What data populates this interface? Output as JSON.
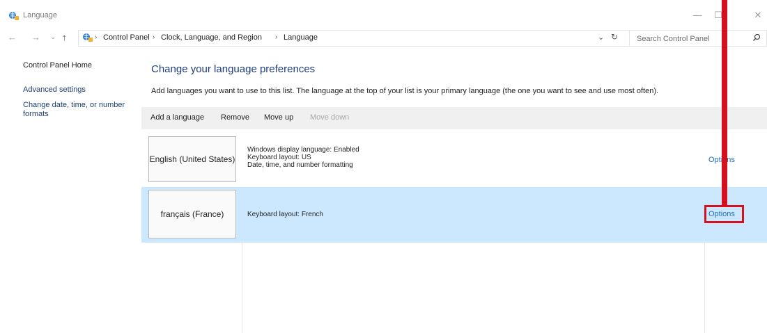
{
  "window": {
    "title": "Language",
    "minimize": "—",
    "maximize": "☐",
    "close": "✕"
  },
  "nav": {
    "back": "←",
    "forward": "→",
    "recent": "⌄",
    "up": "↑"
  },
  "breadcrumb": {
    "items": [
      "Control Panel",
      "Clock, Language, and Region",
      "Language"
    ],
    "separator": "›",
    "dropdown": "⌄",
    "refresh": "↻"
  },
  "search": {
    "placeholder": "Search Control Panel"
  },
  "sidebar": {
    "home": "Control Panel Home",
    "advanced": "Advanced settings",
    "formats": "Change date, time, or number formats"
  },
  "main": {
    "heading": "Change your language preferences",
    "description": "Add languages you want to use to this list. The language at the top of your list is your primary language (the one you want to see and use most often)."
  },
  "toolbar": {
    "add": "Add a language",
    "remove": "Remove",
    "move_up": "Move up",
    "move_down": "Move down"
  },
  "languages": [
    {
      "name": "English (United States)",
      "details": [
        "Windows display language: Enabled",
        "Keyboard layout: US",
        "Date, time, and number formatting"
      ],
      "options": "Options",
      "selected": false
    },
    {
      "name": "français (France)",
      "details": [
        "Keyboard layout: French"
      ],
      "options": "Options",
      "selected": true
    }
  ],
  "colors": {
    "selection": "#cce8ff",
    "link": "#1e6fc0",
    "annotation": "#d4121f"
  }
}
